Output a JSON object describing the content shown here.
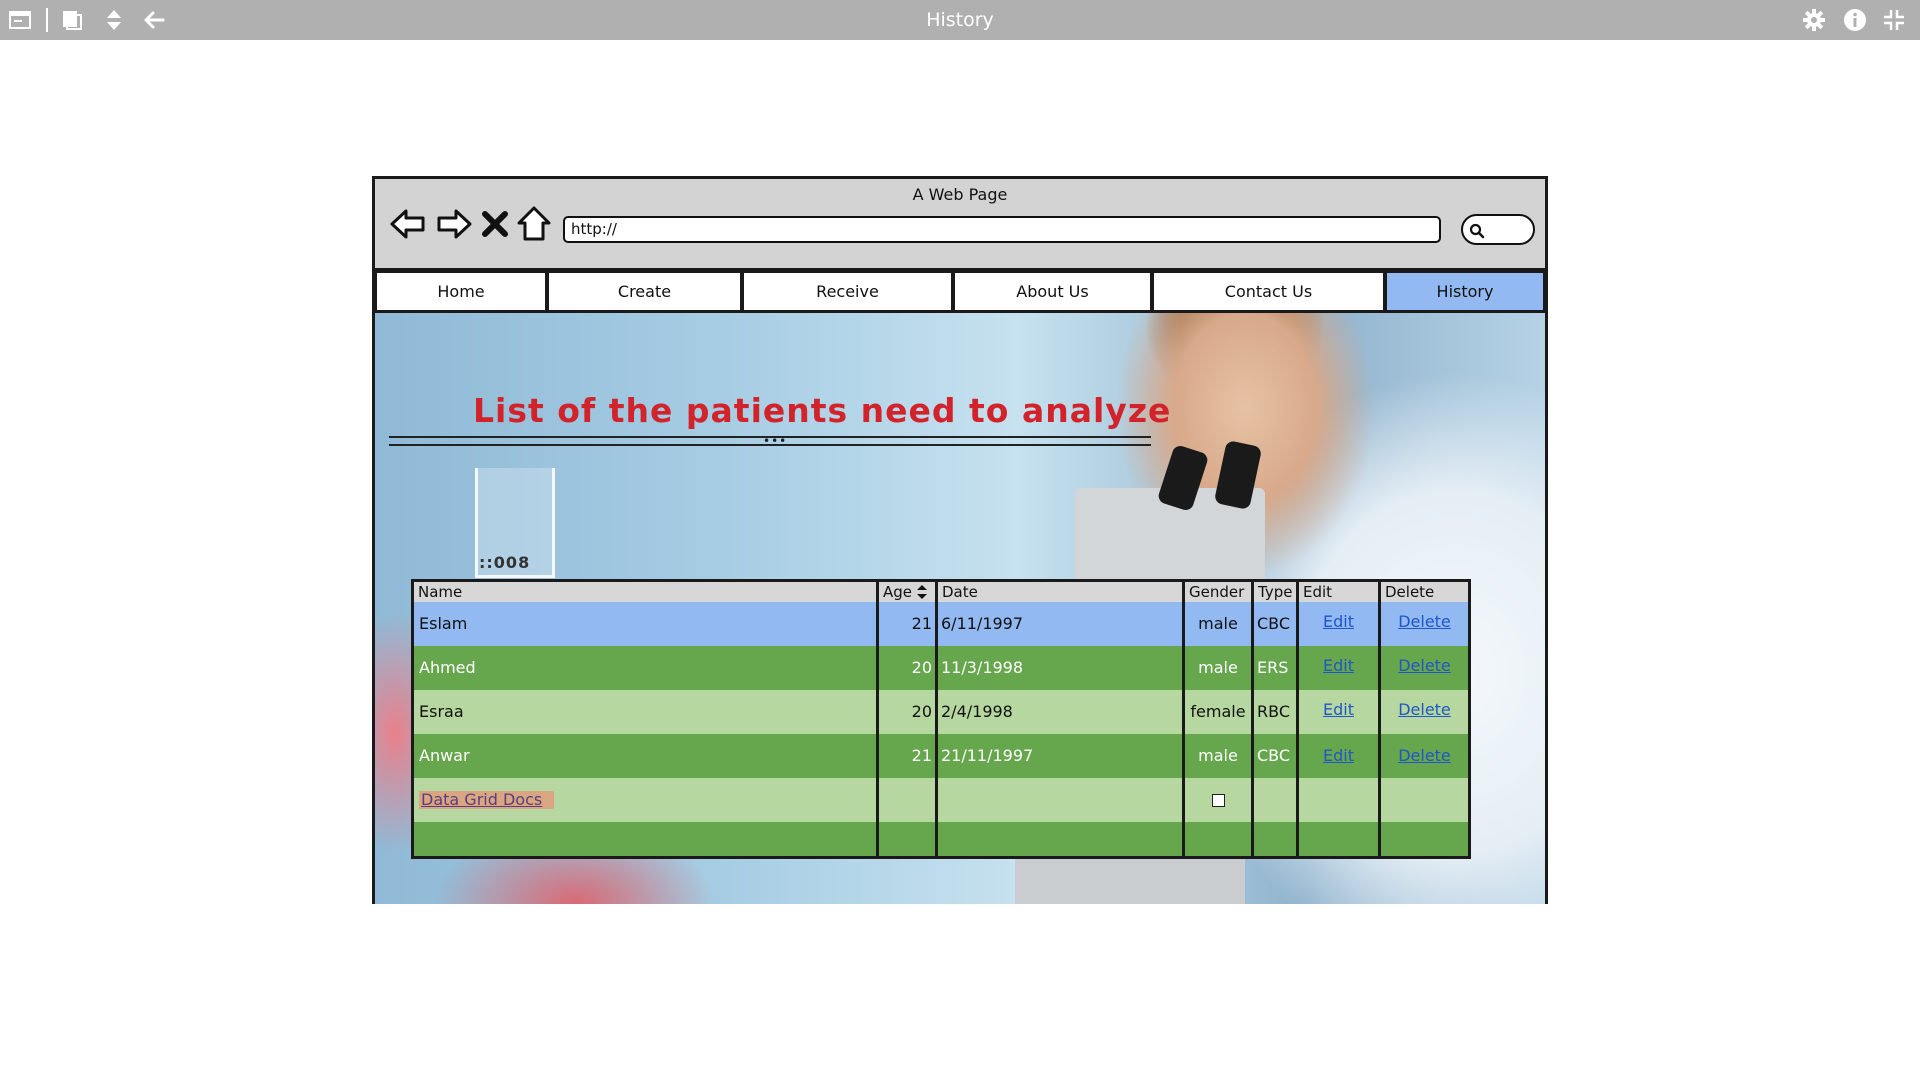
{
  "app": {
    "title": "History",
    "icons": [
      "window-icon",
      "copy-icon",
      "sort-arrows-icon",
      "back-arrow-icon",
      "gear-icon",
      "info-icon",
      "collapse-icon"
    ]
  },
  "browser": {
    "title": "A Web Page",
    "url": "http://",
    "nav_icons": [
      "back-icon",
      "forward-icon",
      "close-icon",
      "home-icon",
      "search-icon"
    ]
  },
  "tabs": [
    {
      "label": "Home",
      "active": false
    },
    {
      "label": "Create",
      "active": false
    },
    {
      "label": "Receive",
      "active": false
    },
    {
      "label": "About Us",
      "active": false
    },
    {
      "label": "Contact Us",
      "active": false
    },
    {
      "label": "History",
      "active": true
    }
  ],
  "page": {
    "heading": "List of the patients need to analyze",
    "divider_mark": "•••",
    "photo_label": "::008"
  },
  "grid": {
    "columns": [
      "Name",
      "Age",
      "Date",
      "Gender",
      "Type",
      "Edit",
      "Delete"
    ],
    "sort_column": "Age",
    "rows": [
      {
        "name": "Eslam",
        "age": "21",
        "date": "6/11/1997",
        "gender": "male",
        "type": "CBC",
        "edit": "Edit",
        "delete": "Delete"
      },
      {
        "name": "Ahmed",
        "age": "20",
        "date": "11/3/1998",
        "gender": "male",
        "type": "ERS",
        "edit": "Edit",
        "delete": "Delete"
      },
      {
        "name": "Esraa",
        "age": "20",
        "date": "2/4/1998",
        "gender": "female",
        "type": "RBC",
        "edit": "Edit",
        "delete": "Delete"
      },
      {
        "name": "Anwar",
        "age": "21",
        "date": "21/11/1997",
        "gender": "male",
        "type": "CBC",
        "edit": "Edit",
        "delete": "Delete"
      }
    ],
    "footer_link": "Data Grid Docs",
    "footer_checkbox_checked": false
  },
  "colors": {
    "toolbar": "#b0b0b0",
    "active_tab": "#92b9f2",
    "heading": "#d2232a",
    "row_selected": "#92b9f2",
    "row_dark": "#66a64d",
    "row_light": "#b6d7a0",
    "link": "#1f57c8"
  }
}
